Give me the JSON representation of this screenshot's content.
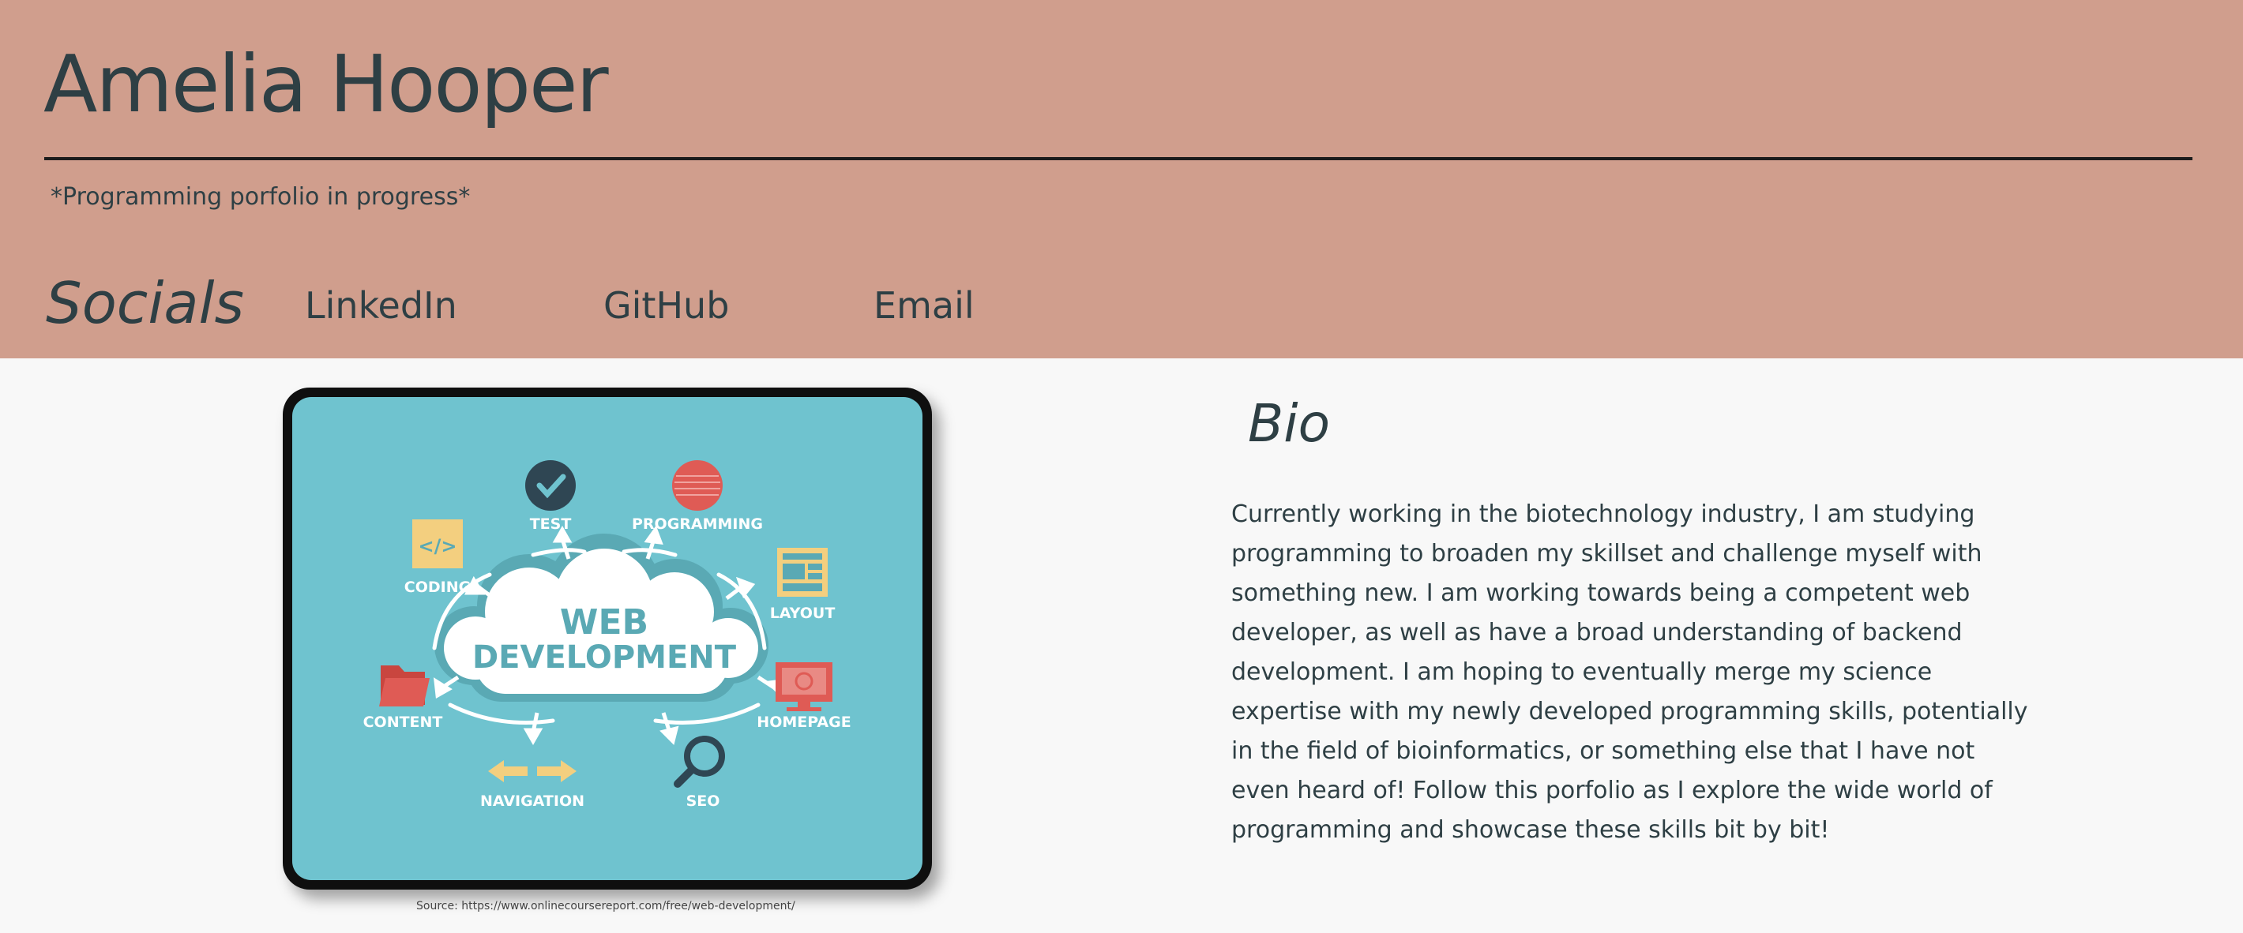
{
  "header": {
    "name": "Amelia Hooper",
    "subtitle": "*Programming porfolio in progress*",
    "socials_label": "Socials",
    "links": [
      "LinkedIn",
      "GitHub",
      "Email"
    ]
  },
  "image": {
    "center_text_line1": "WEB",
    "center_text_line2": "DEVELOPMENT",
    "labels": {
      "test": "TEST",
      "programming": "PROGRAMMING",
      "coding": "CODING",
      "layout": "LAYOUT",
      "content": "CONTENT",
      "homepage": "HOMEPAGE",
      "navigation": "NAVIGATION",
      "seo": "SEO"
    },
    "caption": "Source: https://www.onlinecoursereport.com/free/web-development/"
  },
  "bio": {
    "heading": "Bio",
    "text": "Currently working in the biotechnology industry, I am studying programming to broaden my skillset and challenge myself with something new. I am working towards being a competent web developer, as well as have a broad understanding of backend development. I am hoping to eventually merge my science expertise with my newly developed programming skills, potentially in the field of bioinformatics, or something else that I have not even heard of! Follow this porfolio as I explore the wide world of programming and showcase these skills bit by bit!"
  },
  "colors": {
    "header_bg": "#d09e8d",
    "page_bg": "#f8f8f8",
    "text": "#2e3f44",
    "image_bg": "#6fc3cf"
  }
}
